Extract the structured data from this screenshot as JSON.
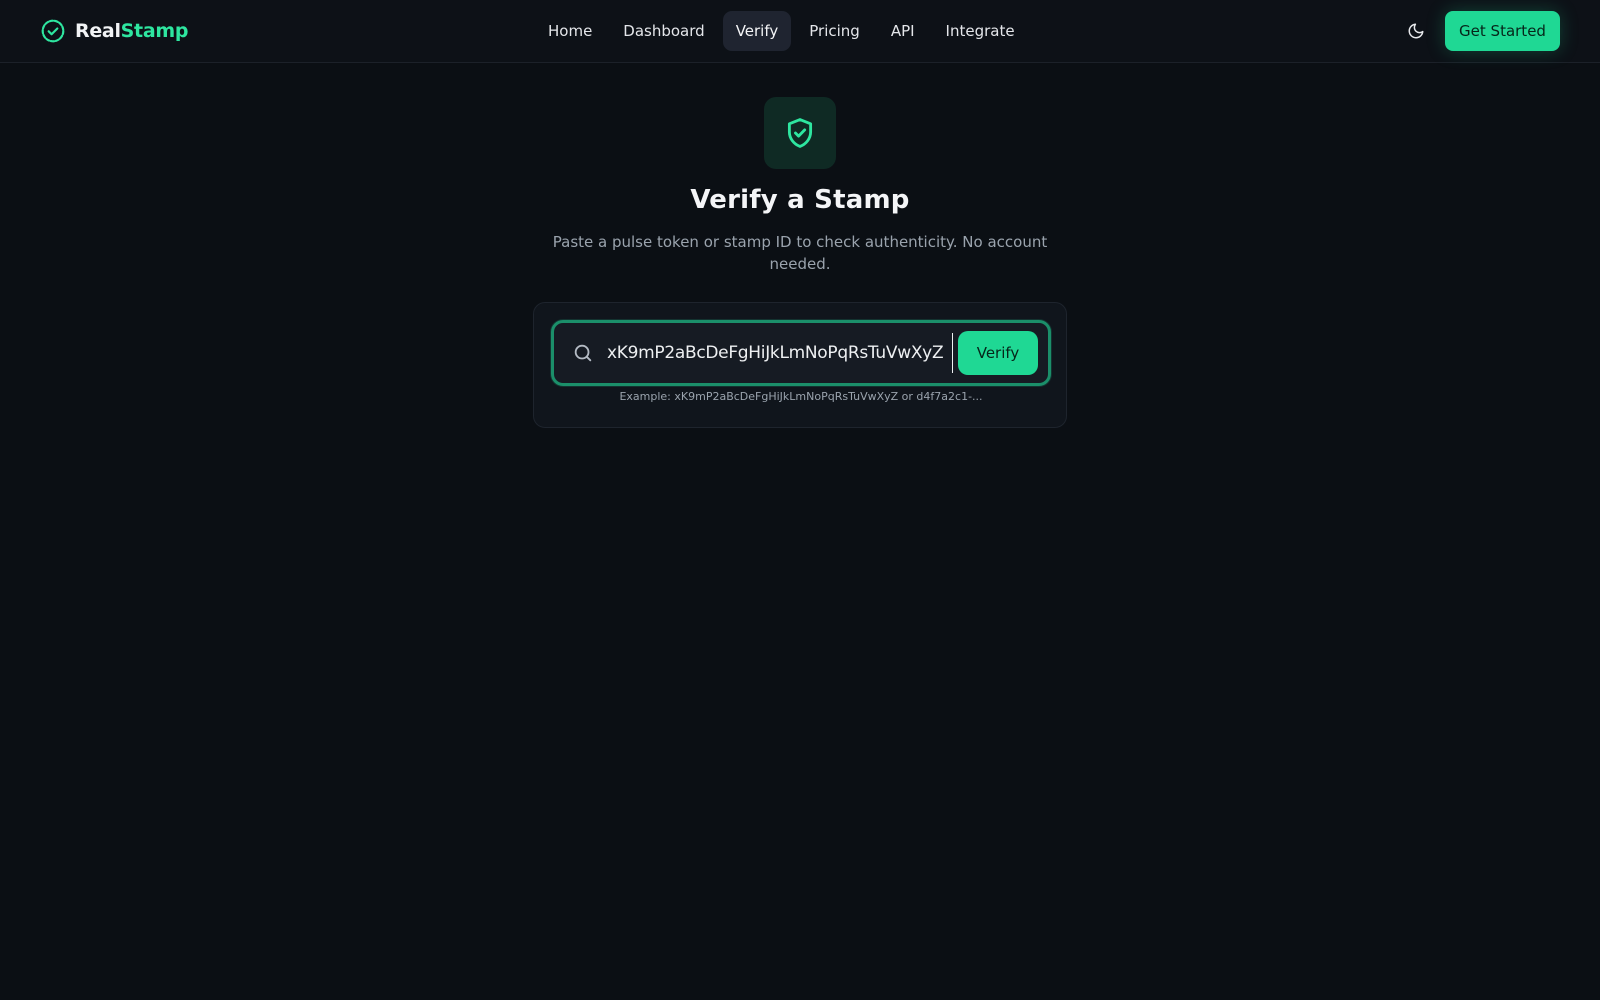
{
  "brand": {
    "part1": "Real",
    "part2": "Stamp",
    "icon": "badge-check-icon"
  },
  "nav": {
    "items": [
      {
        "label": "Home"
      },
      {
        "label": "Dashboard"
      },
      {
        "label": "Verify",
        "active": true
      },
      {
        "label": "Pricing"
      },
      {
        "label": "API"
      },
      {
        "label": "Integrate"
      }
    ]
  },
  "header": {
    "theme_icon": "moon-icon",
    "cta_label": "Get Started"
  },
  "hero": {
    "icon": "shield-check-icon",
    "title": "Verify a Stamp",
    "subtitle": "Paste a pulse token or stamp ID to check authenticity. No account needed."
  },
  "search": {
    "icon": "search-icon",
    "value": "xK9mP2aBcDeFgHiJkLmNoPqRsTuVwXyZ",
    "button_label": "Verify",
    "example": "Example: xK9mP2aBcDeFgHiJkLmNoPqRsTuVwXyZ or d4f7a2c1-..."
  },
  "colors": {
    "accent": "#1fd894",
    "background": "#0b0f14",
    "input_border": "#1b8f6a"
  }
}
